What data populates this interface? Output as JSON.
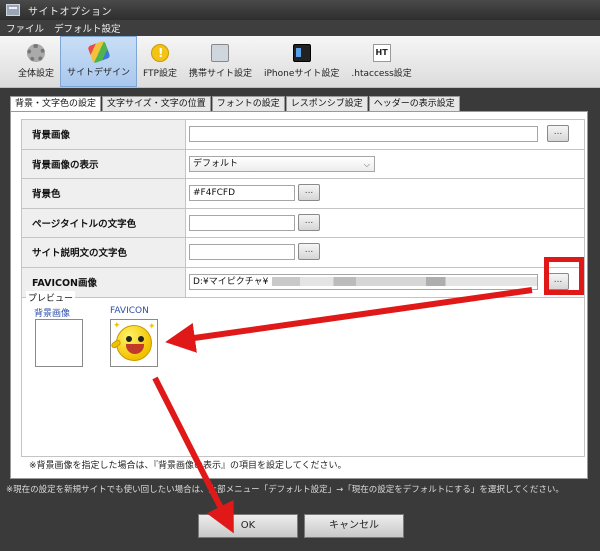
{
  "window": {
    "title": "サイトオプション"
  },
  "menu": {
    "items": [
      "ファイル",
      "デフォルト設定"
    ]
  },
  "toolbar": {
    "items": [
      {
        "label": "全体設定",
        "icon": "gear-icon"
      },
      {
        "label": "サイトデザイン",
        "icon": "design-palette-icon",
        "active": true
      },
      {
        "label": "FTP設定",
        "icon": "ftp-icon"
      },
      {
        "label": "携帯サイト設定",
        "icon": "mobile-phone-icon"
      },
      {
        "label": "iPhoneサイト設定",
        "icon": "iphone-icon"
      },
      {
        "label": ".htaccess設定",
        "icon": "htaccess-icon",
        "glyph": "HT"
      }
    ]
  },
  "tabs": [
    {
      "label": "背景・文字色の設定",
      "active": true
    },
    {
      "label": "文字サイズ・文字の位置"
    },
    {
      "label": "フォントの設定"
    },
    {
      "label": "レスポンシブ設定"
    },
    {
      "label": "ヘッダーの表示設定"
    }
  ],
  "form": {
    "rows": [
      {
        "label": "背景画像",
        "value": ""
      },
      {
        "label": "背景画像の表示",
        "value": "デフォルト"
      },
      {
        "label": "背景色",
        "value": "#F4FCFD"
      },
      {
        "label": "ページタイトルの文字色",
        "value": ""
      },
      {
        "label": "サイト説明文の文字色",
        "value": ""
      },
      {
        "label": "FAVICON画像",
        "value": "D:¥マイピクチャ¥"
      }
    ],
    "browse_label": "..."
  },
  "preview": {
    "legend": "プレビュー",
    "background_label": "背景画像",
    "favicon_label": "FAVICON"
  },
  "note": "※背景画像を指定した場合は、『背景画像の表示』の項目を設定してください。",
  "status": "※現在の設定を新規サイトでも使い回したい場合は、上部メニュー「デフォルト設定」→「現在の設定をデフォルトにする」を選択してください。",
  "buttons": {
    "ok": "OK",
    "cancel": "キャンセル"
  },
  "colors": {
    "highlight": "#e01818",
    "active_tab_bg": "#a9c8ee",
    "favicon_yellow": "#f2c200"
  }
}
